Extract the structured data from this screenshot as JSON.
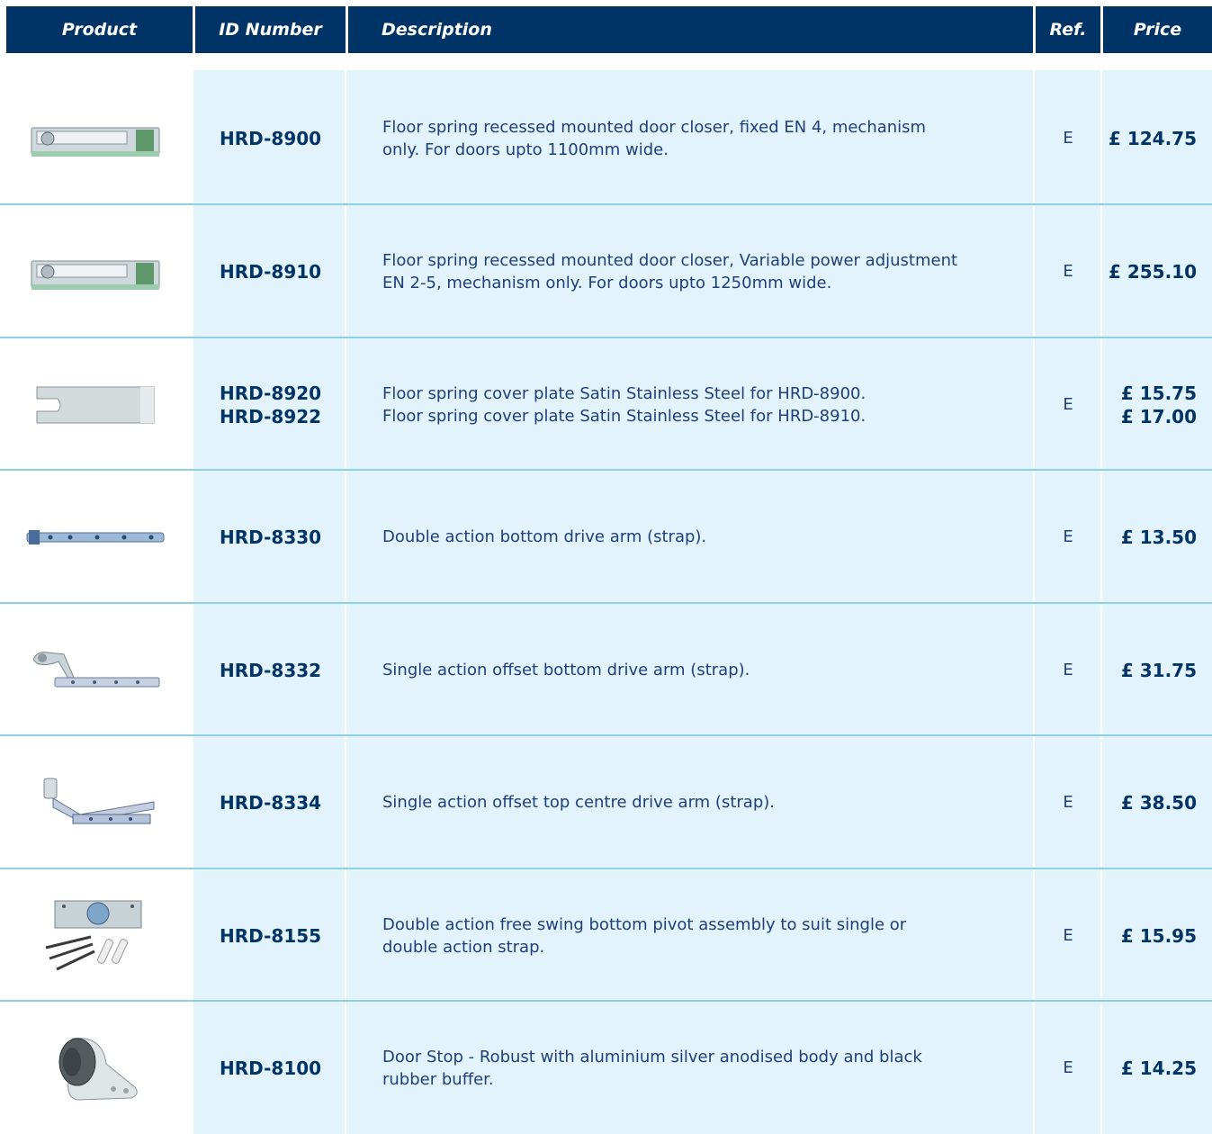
{
  "header": {
    "product": "Product",
    "id_number": "ID Number",
    "description": "Description",
    "ref": "Ref.",
    "price": "Price"
  },
  "rows": [
    {
      "image_icon": "floor-spring-closer-image",
      "ids": [
        "HRD-8900"
      ],
      "description": [
        "Floor spring recessed mounted door closer, fixed EN 4, mechanism",
        "only. For doors upto 1100mm wide."
      ],
      "ref": "E",
      "prices": [
        "£ 124.75"
      ]
    },
    {
      "image_icon": "floor-spring-closer-image",
      "ids": [
        "HRD-8910"
      ],
      "description": [
        "Floor spring recessed mounted door closer, Variable power adjustment",
        "EN 2-5, mechanism only. For doors upto 1250mm wide."
      ],
      "ref": "E",
      "prices": [
        "£ 255.10"
      ]
    },
    {
      "image_icon": "cover-plate-image",
      "ids": [
        "HRD-8920",
        "HRD-8922"
      ],
      "description": [
        "Floor spring cover plate Satin Stainless Steel for HRD-8900.",
        "Floor spring cover plate Satin Stainless Steel for HRD-8910."
      ],
      "ref": "E",
      "prices": [
        "£ 15.75",
        "£ 17.00"
      ]
    },
    {
      "image_icon": "drive-arm-strap-image",
      "ids": [
        "HRD-8330"
      ],
      "description": [
        "Double action bottom drive arm (strap)."
      ],
      "ref": "E",
      "prices": [
        "£ 13.50"
      ]
    },
    {
      "image_icon": "offset-drive-arm-image",
      "ids": [
        "HRD-8332"
      ],
      "description": [
        "Single action offset bottom drive arm (strap)."
      ],
      "ref": "E",
      "prices": [
        "£ 31.75"
      ]
    },
    {
      "image_icon": "top-centre-drive-arm-image",
      "ids": [
        "HRD-8334"
      ],
      "description": [
        "Single action offset top centre drive arm (strap)."
      ],
      "ref": "E",
      "prices": [
        "£ 38.50"
      ]
    },
    {
      "image_icon": "bottom-pivot-assembly-image",
      "ids": [
        "HRD-8155"
      ],
      "description": [
        "Double action free swing bottom pivot assembly to suit single or",
        "double action strap."
      ],
      "ref": "E",
      "prices": [
        "£ 15.95"
      ]
    },
    {
      "image_icon": "door-stop-image",
      "ids": [
        "HRD-8100"
      ],
      "description": [
        "Door Stop - Robust with aluminium silver anodised body and black",
        "rubber buffer."
      ],
      "ref": "E",
      "prices": [
        "£ 14.25"
      ]
    }
  ],
  "colors": {
    "header_bg": "#003366",
    "row_bg": "#e3f3fb",
    "divider": "#8fcfe6",
    "text": "#003366"
  }
}
